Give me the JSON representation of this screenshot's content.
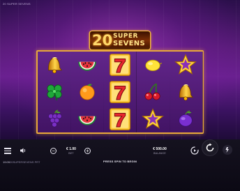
{
  "game": {
    "title_small": "20 SUPER SEVENS",
    "logo": {
      "number": "20",
      "word_top": "SUPER",
      "word_bottom": "SEVENS"
    }
  },
  "reels": [
    [
      "bell",
      "clover",
      "grapes"
    ],
    [
      "watermelon",
      "orange",
      "watermelon"
    ],
    [
      "seven",
      "seven",
      "seven"
    ],
    [
      "lemon",
      "cherries",
      "star"
    ],
    [
      "star",
      "bell",
      "plum"
    ]
  ],
  "controls": {
    "bet": {
      "value": "€ 1.00",
      "label": "BET"
    },
    "balance": {
      "value": "€ 500.00",
      "label": "BALANCE"
    },
    "minus_symbol": "−",
    "plus_symbol": "+"
  },
  "footer": {
    "time": "19:09",
    "game_name": "20SUPERSEVENS PRT",
    "message": "PRESS SPIN TO BEGIN"
  },
  "colors": {
    "frame": "#e7a83a",
    "background_top": "#2a0f4a",
    "background_mid": "#6a2090",
    "bar": "#0b0914"
  },
  "icons": {
    "menu": "hamburger-menu-icon",
    "sound": "speaker-icon",
    "autoplay": "autoplay-icon",
    "spin": "spin-arrow-icon",
    "turbo": "turbo-icon"
  }
}
